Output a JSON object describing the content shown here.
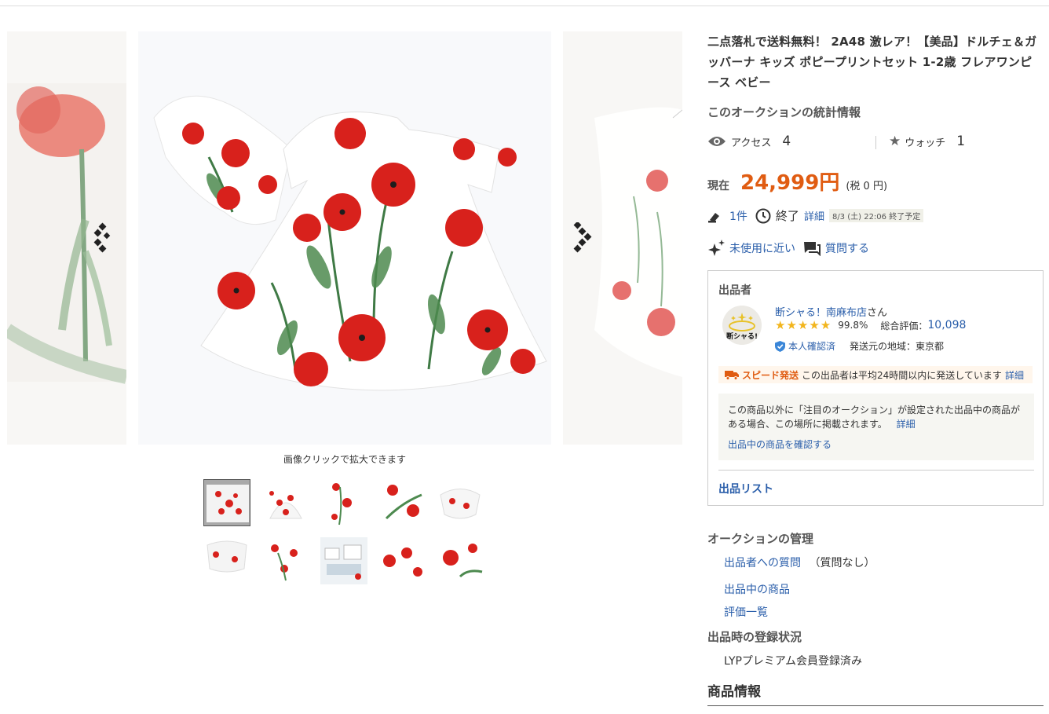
{
  "gallery": {
    "caption": "画像クリックで拡大できます",
    "prev_icon": "chevron-left-icon",
    "next_icon": "chevron-right-icon",
    "thumbnail_count": 10,
    "active_thumbnail": 1
  },
  "item": {
    "title": "二点落札で送料無料！ 2A48 激レア！【美品】ドルチェ＆ガッバーナ キッズ ポピープリントセット 1-2歳 フレアワンピース ベビー"
  },
  "stats": {
    "heading": "このオークションの統計情報",
    "access_label": "アクセス",
    "access_value": "4",
    "watch_label": "ウォッチ",
    "watch_value": "1"
  },
  "price": {
    "label": "現在",
    "value": "24,999円",
    "tax": "(税 0 円)",
    "color": "#e05c12"
  },
  "bids": {
    "count": "1件",
    "status": "終了",
    "detail_link": "詳細",
    "end_time": "8/3 (土) 22:06 終了予定"
  },
  "condition": {
    "label": "未使用に近い",
    "ask_link": "質問する"
  },
  "seller": {
    "heading": "出品者",
    "avatar_text": "断シャる!",
    "name": "断シャる！南麻布店",
    "name_suffix": "さん",
    "stars": "★★★★★",
    "rating_percent": "99.8%",
    "total_label": "総合評価：",
    "total_value": "10,098",
    "verified": "本人確認済",
    "location": "発送元の地域：東京都",
    "speed_label": "スピード発送",
    "speed_text": "この出品者は平均24時間以内に発送しています",
    "speed_link": "詳細",
    "notice_text": "この商品以外に「注目のオークション」が設定された出品中の商品がある場合、この場所に掲載されます。",
    "notice_link": "詳細",
    "notice_check_link": "出品中の商品を確認する",
    "list_link": "出品リスト"
  },
  "management": {
    "heading": "オークションの管理",
    "question_link": "出品者への質問",
    "question_status": "（質問なし）",
    "listing_link": "出品中の商品",
    "review_link": "評価一覧"
  },
  "registration": {
    "heading": "出品時の登録状況",
    "value": "LYPプレミアム会員登録済み"
  },
  "product_info": {
    "heading": "商品情報"
  },
  "colors": {
    "link": "#2a5eaa",
    "accent": "#e05c12",
    "star": "#f2b51d"
  }
}
